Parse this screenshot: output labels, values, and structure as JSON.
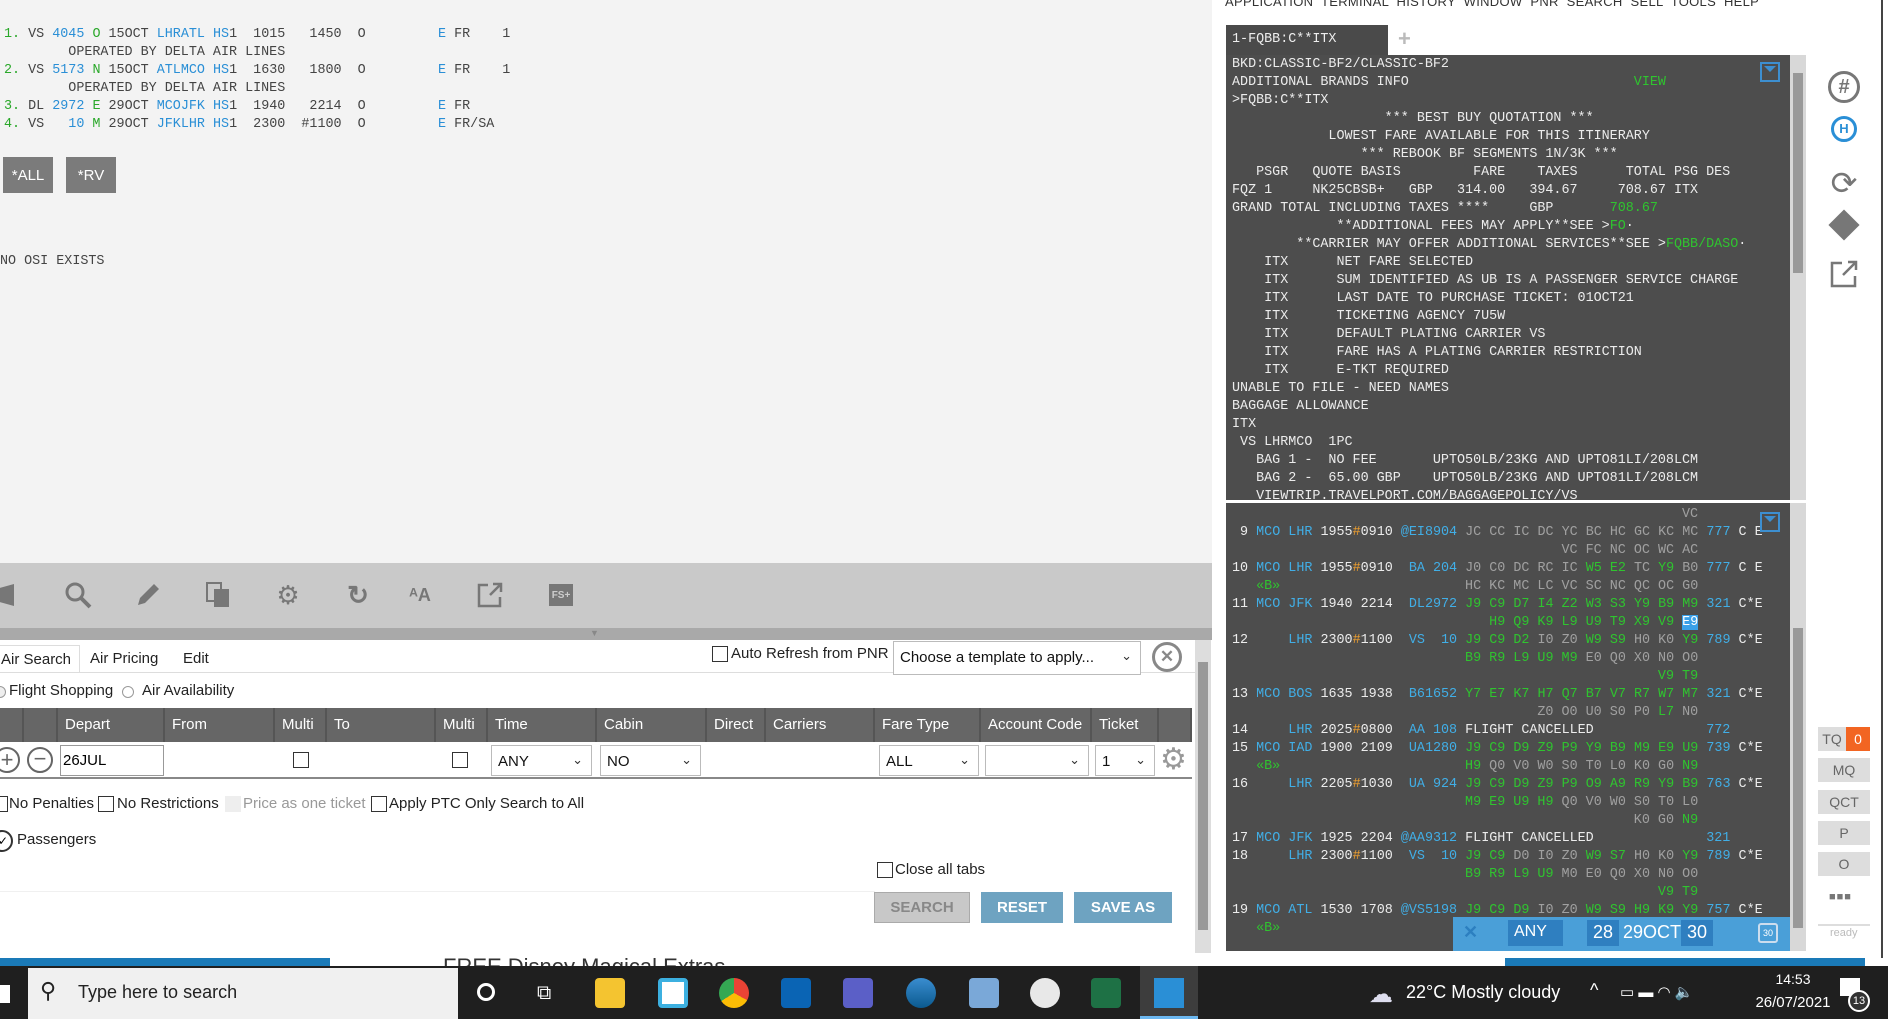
{
  "colors": {
    "w": "#ececec",
    "b": "#41aee6",
    "g": "#2fc42f",
    "d": "#a0a0a0",
    "o": "#f0a030",
    "lb": "#2a8fd6",
    "lg": "#2aa82a",
    "lt": "#444444"
  },
  "left_terminal": {
    "lines": [
      [
        [
          "1.",
          "lg"
        ],
        [
          " VS ",
          "lt"
        ],
        [
          "4045",
          "lb"
        ],
        [
          " ",
          "lt"
        ],
        [
          "O",
          "lg"
        ],
        [
          " 15OCT ",
          "lt"
        ],
        [
          "LHRATL",
          "lb"
        ],
        [
          " ",
          "lt"
        ],
        [
          "HS",
          "lb"
        ],
        [
          "1  1015   1450  O         ",
          "lt"
        ],
        [
          "E",
          "lb"
        ],
        [
          " FR    1",
          "lt"
        ]
      ],
      [
        [
          "        OPERATED BY DELTA AIR LINES",
          "lt"
        ]
      ],
      [
        [
          "2.",
          "lg"
        ],
        [
          " VS ",
          "lt"
        ],
        [
          "5173",
          "lb"
        ],
        [
          " ",
          "lt"
        ],
        [
          "N",
          "lg"
        ],
        [
          " 15OCT ",
          "lt"
        ],
        [
          "ATLMCO",
          "lb"
        ],
        [
          " ",
          "lt"
        ],
        [
          "HS",
          "lb"
        ],
        [
          "1  1630   1800  O         ",
          "lt"
        ],
        [
          "E",
          "lb"
        ],
        [
          " FR    1",
          "lt"
        ]
      ],
      [
        [
          "        OPERATED BY DELTA AIR LINES",
          "lt"
        ]
      ],
      [
        [
          "3.",
          "lg"
        ],
        [
          " DL ",
          "lt"
        ],
        [
          "2972",
          "lb"
        ],
        [
          " ",
          "lt"
        ],
        [
          "E",
          "lg"
        ],
        [
          " 29OCT ",
          "lt"
        ],
        [
          "MCOJFK",
          "lb"
        ],
        [
          " ",
          "lt"
        ],
        [
          "HS",
          "lb"
        ],
        [
          "1  1940   2214  O         ",
          "lt"
        ],
        [
          "E",
          "lb"
        ],
        [
          " FR",
          "lt"
        ]
      ],
      [
        [
          "4.",
          "lg"
        ],
        [
          " VS   ",
          "lt"
        ],
        [
          "10",
          "lb"
        ],
        [
          " ",
          "lt"
        ],
        [
          "M",
          "lg"
        ],
        [
          " 29OCT ",
          "lt"
        ],
        [
          "JFKLHR",
          "lb"
        ],
        [
          " ",
          "lt"
        ],
        [
          "HS",
          "lb"
        ],
        [
          "1  2300  #1100  O         ",
          "lt"
        ],
        [
          "E",
          "lb"
        ],
        [
          " FR/SA",
          "lt"
        ]
      ]
    ],
    "btn_all": "*ALL",
    "btn_rv": "*RV",
    "osi": "NO OSI EXISTS"
  },
  "form": {
    "tabs": [
      "Air Search",
      "Air Pricing",
      "Edit"
    ],
    "auto_refresh": "Auto Refresh from PNR",
    "template_placeholder": "Choose a template to apply...",
    "mode_flight_shopping": "Flight Shopping",
    "mode_air_availability": "Air Availability",
    "columns": [
      "Depart",
      "From",
      "Multi",
      "To",
      "Multi",
      "Time",
      "Cabin",
      "Direct",
      "Carriers",
      "Fare Type",
      "Account Code",
      "Ticket"
    ],
    "depart_value": "26JUL",
    "time_value": "ANY",
    "cabin_value": "NO",
    "fare_type_value": "ALL",
    "account_code_value": "",
    "ticket_value": "1",
    "options": [
      "No Penalties",
      "No Restrictions",
      "Price as one ticket",
      "Apply PTC Only Search to All"
    ],
    "passengers": "Passengers",
    "close_all_tabs": "Close all tabs",
    "search": "SEARCH",
    "reset": "RESET",
    "save_as": "SAVE AS"
  },
  "menu": "APPLICATION  TERMINAL  HISTORY  WINDOW  PNR  SEARCH  SELL  TOOLS  HELP",
  "terminal_tab": "1-FQBB:C**ITX",
  "terminal_top": [
    [
      [
        "BKD:CLASSIC-BF2/CLASSIC-BF2",
        "w"
      ]
    ],
    [
      [
        "ADDITIONAL BRANDS INFO                            ",
        "w"
      ],
      [
        "VIEW",
        "g"
      ]
    ],
    [
      [
        ">FQBB:C**ITX",
        "w"
      ]
    ],
    [
      [
        "                   *** BEST BUY QUOTATION ***",
        "w"
      ]
    ],
    [
      [
        "            LOWEST FARE AVAILABLE FOR THIS ITINERARY",
        "w"
      ]
    ],
    [
      [
        "                *** REBOOK BF SEGMENTS 1N/3K ***",
        "w"
      ]
    ],
    [
      [
        "   PSGR   QUOTE BASIS         FARE    TAXES      TOTAL PSG DES",
        "w"
      ]
    ],
    [
      [
        "FQZ 1     NK25CBSB+   GBP   314.00   394.67     708.67 ITX",
        "w"
      ]
    ],
    [
      [
        "GRAND TOTAL INCLUDING TAXES ****     GBP       ",
        "w"
      ],
      [
        "708.67",
        "g"
      ]
    ],
    [
      [
        "             **ADDITIONAL FEES MAY APPLY**SEE >",
        "w"
      ],
      [
        "FO",
        "g"
      ],
      [
        "·",
        "w"
      ]
    ],
    [
      [
        "        **CARRIER MAY OFFER ADDITIONAL SERVICES**SEE >",
        "w"
      ],
      [
        "FQBB/DASO",
        "g"
      ],
      [
        "·",
        "w"
      ]
    ],
    [
      [
        "    ITX      NET FARE SELECTED",
        "w"
      ]
    ],
    [
      [
        "    ITX      SUM IDENTIFIED AS UB IS A PASSENGER SERVICE CHARGE",
        "w"
      ]
    ],
    [
      [
        "    ITX      LAST DATE TO PURCHASE TICKET: 01OCT21",
        "w"
      ]
    ],
    [
      [
        "    ITX      TICKETING AGENCY 7U5W",
        "w"
      ]
    ],
    [
      [
        "    ITX      DEFAULT PLATING CARRIER VS",
        "w"
      ]
    ],
    [
      [
        "    ITX      FARE HAS A PLATING CARRIER RESTRICTION",
        "w"
      ]
    ],
    [
      [
        "    ITX      E-TKT REQUIRED",
        "w"
      ]
    ],
    [
      [
        "UNABLE TO FILE - NEED NAMES",
        "w"
      ]
    ],
    [
      [
        "BAGGAGE ALLOWANCE",
        "w"
      ]
    ],
    [
      [
        "ITX",
        "w"
      ]
    ],
    [
      [
        " VS LHRMCO  1PC",
        "w"
      ]
    ],
    [
      [
        "   BAG 1 -  NO FEE       UPTO50LB/23KG AND UPTO81LI/208LCM",
        "w"
      ]
    ],
    [
      [
        "   BAG 2 -  65.00 GBP    UPTO50LB/23KG AND UPTO81LI/208LCM",
        "w"
      ]
    ],
    [
      [
        "   VIEWTRIP.TRAVELPORT.COM/BAGGAGEPOLICY/VS",
        "w"
      ]
    ]
  ],
  "availability": [
    {
      "cont": 56,
      "classes": [
        "VC"
      ]
    },
    {
      "idx": " 9",
      "from": "MCO",
      "to": "LHR",
      "dep": "1955",
      "sep": "#",
      "arr": "0910",
      "flight": "@EI8904",
      "classes": [
        "JC",
        "CC",
        "IC",
        "DC",
        "YC",
        "BC",
        "HC",
        "GC",
        "KC",
        "MC"
      ],
      "equip": "777",
      "flags": "C E"
    },
    {
      "cont": 41,
      "classes": [
        "VC",
        "FC",
        "NC",
        "OC",
        "WC",
        "AC"
      ]
    },
    {
      "idx": "10",
      "from": "MCO",
      "to": "LHR",
      "dep": "1955",
      "sep": "#",
      "arr": "0910",
      "flight": " BA 204",
      "classes": [
        "J0",
        "C0",
        "DC",
        "RC",
        "IC",
        "W5",
        "E2",
        "TC",
        "Y9",
        "B0"
      ],
      "equip": "777",
      "flags": "C E"
    },
    {
      "cont": 29,
      "tag": "«B»",
      "classes": [
        "HC",
        "KC",
        "MC",
        "LC",
        "VC",
        "SC",
        "NC",
        "QC",
        "OC",
        "G0"
      ]
    },
    {
      "idx": "11",
      "from": "MCO",
      "to": "JFK",
      "dep": "1940",
      "sep": " ",
      "arr": "2214",
      "flight": " DL2972",
      "classes": [
        "J9",
        "C9",
        "D7",
        "I4",
        "Z2",
        "W3",
        "S3",
        "Y9",
        "B9",
        "M9"
      ],
      "equip": "321",
      "flags": "C*E"
    },
    {
      "cont": 32,
      "classes": [
        "H9",
        "Q9",
        "K9",
        "L9",
        "U9",
        "T9",
        "X9",
        "V9",
        "E9"
      ],
      "selected": "E9"
    },
    {
      "idx": "12",
      "from": "",
      "to": "LHR",
      "dep": "2300",
      "sep": "#",
      "arr": "1100",
      "flight": " VS  10",
      "classes": [
        "J9",
        "C9",
        "D2",
        "I0",
        "Z0",
        "W9",
        "S9",
        "H0",
        "K0",
        "Y9"
      ],
      "equip": "789",
      "flags": "C*E"
    },
    {
      "cont": 29,
      "classes": [
        "B9",
        "R9",
        "L9",
        "U9",
        "M9",
        "E0",
        "Q0",
        "X0",
        "N0",
        "O0"
      ]
    },
    {
      "cont": 53,
      "classes": [
        "V9",
        "T9"
      ]
    },
    {
      "idx": "13",
      "from": "MCO",
      "to": "BOS",
      "dep": "1635",
      "sep": " ",
      "arr": "1938",
      "flight": " B61652",
      "classes": [
        "Y7",
        "E7",
        "K7",
        "H7",
        "Q7",
        "B7",
        "V7",
        "R7",
        "W7",
        "M7"
      ],
      "equip": "321",
      "flags": "C*E"
    },
    {
      "cont": 38,
      "classes": [
        "Z0",
        "O0",
        "U0",
        "S0",
        "P0",
        "L7",
        "N0"
      ]
    },
    {
      "idx": "14",
      "from": "",
      "to": "LHR",
      "dep": "2025",
      "sep": "#",
      "arr": "0800",
      "flight": " AA 108",
      "note": "FLIGHT CANCELLED",
      "equip": "772",
      "flags": ""
    },
    {
      "idx": "15",
      "from": "MCO",
      "to": "IAD",
      "dep": "1900",
      "sep": " ",
      "arr": "2109",
      "flight": " UA1280",
      "classes": [
        "J9",
        "C9",
        "D9",
        "Z9",
        "P9",
        "Y9",
        "B9",
        "M9",
        "E9",
        "U9"
      ],
      "equip": "739",
      "flags": "C*E"
    },
    {
      "cont": 29,
      "tag": "«B»",
      "classes": [
        "H9",
        "Q0",
        "V0",
        "W0",
        "S0",
        "T0",
        "L0",
        "K0",
        "G0",
        "N9"
      ]
    },
    {
      "idx": "16",
      "from": "",
      "to": "LHR",
      "dep": "2205",
      "sep": "#",
      "arr": "1030",
      "flight": " UA 924",
      "classes": [
        "J9",
        "C9",
        "D9",
        "Z9",
        "P9",
        "O9",
        "A9",
        "R9",
        "Y9",
        "B9"
      ],
      "equip": "763",
      "flags": "C*E"
    },
    {
      "cont": 29,
      "classes": [
        "M9",
        "E9",
        "U9",
        "H9",
        "Q0",
        "V0",
        "W0",
        "S0",
        "T0",
        "L0"
      ]
    },
    {
      "cont": 50,
      "classes": [
        "K0",
        "G0",
        "N9"
      ]
    },
    {
      "idx": "17",
      "from": "MCO",
      "to": "JFK",
      "dep": "1925",
      "sep": " ",
      "arr": "2204",
      "flight": "@AA9312",
      "note": "FLIGHT CANCELLED",
      "equip": "321",
      "flags": ""
    },
    {
      "idx": "18",
      "from": "",
      "to": "LHR",
      "dep": "2300",
      "sep": "#",
      "arr": "1100",
      "flight": " VS  10",
      "classes": [
        "J9",
        "C9",
        "D0",
        "I0",
        "Z0",
        "W9",
        "S7",
        "H0",
        "K0",
        "Y9"
      ],
      "equip": "789",
      "flags": "C*E"
    },
    {
      "cont": 29,
      "classes": [
        "B9",
        "R9",
        "L9",
        "U9",
        "M0",
        "E0",
        "Q0",
        "X0",
        "N0",
        "O0"
      ]
    },
    {
      "cont": 53,
      "classes": [
        "V9",
        "T9"
      ]
    },
    {
      "idx": "19",
      "from": "MCO",
      "to": "ATL",
      "dep": "1530",
      "sep": " ",
      "arr": "1708",
      "flight": "@VS5198",
      "classes": [
        "J9",
        "C9",
        "D9",
        "I0",
        "Z0",
        "W9",
        "S9",
        "H9",
        "K9",
        "Y9"
      ],
      "equip": "757",
      "flags": "C*E"
    },
    {
      "cont": 29,
      "tag": "«B»",
      "classes": []
    }
  ],
  "date_bar": {
    "time": "ANY",
    "prev": "28",
    "current": "29OCT",
    "next": "30",
    "calendar_day": "30"
  },
  "side_buttons": [
    "TQ",
    "MQ",
    "QCT",
    "P",
    "O"
  ],
  "tq_count": "0",
  "status": "ready",
  "taskbar": {
    "search_placeholder": "Type here to search",
    "preview_title": "FREE Disney Magical Extras",
    "weather": "22°C  Mostly cloudy",
    "time": "14:53",
    "date": "26/07/2021",
    "notifications": "13"
  }
}
